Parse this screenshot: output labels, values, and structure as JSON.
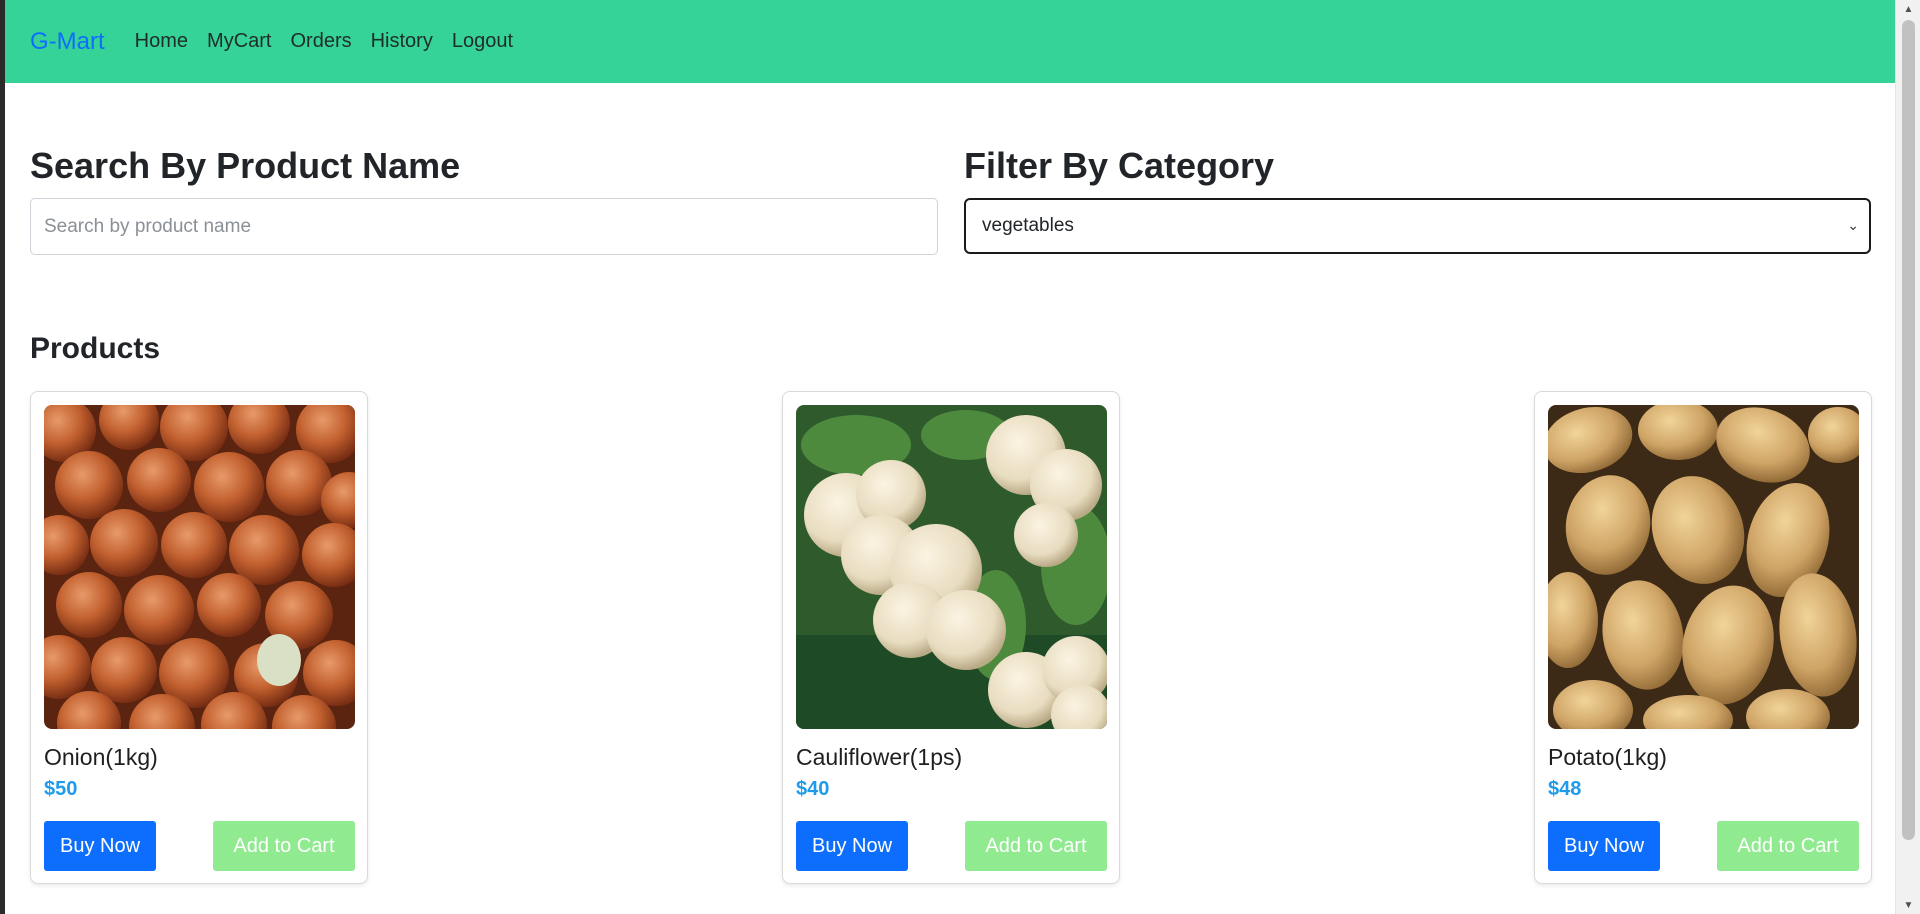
{
  "nav": {
    "brand": "G-Mart",
    "links": [
      "Home",
      "MyCart",
      "Orders",
      "History",
      "Logout"
    ]
  },
  "search": {
    "title": "Search By Product Name",
    "placeholder": "Search by product name",
    "value": ""
  },
  "filter": {
    "title": "Filter By Category",
    "selected": "vegetables"
  },
  "products_title": "Products",
  "products": [
    {
      "name": "Onion(1kg)",
      "price": "$50",
      "buy_label": "Buy Now",
      "cart_label": "Add to Cart"
    },
    {
      "name": "Cauliflower(1ps)",
      "price": "$40",
      "buy_label": "Buy Now",
      "cart_label": "Add to Cart"
    },
    {
      "name": "Potato(1kg)",
      "price": "$48",
      "buy_label": "Buy Now",
      "cart_label": "Add to Cart"
    }
  ],
  "colors": {
    "navbar": "#36d399",
    "brand": "#0d6efd",
    "buy_button": "#0d6efd",
    "cart_button": "#90ea90",
    "price": "#1e9bea"
  }
}
